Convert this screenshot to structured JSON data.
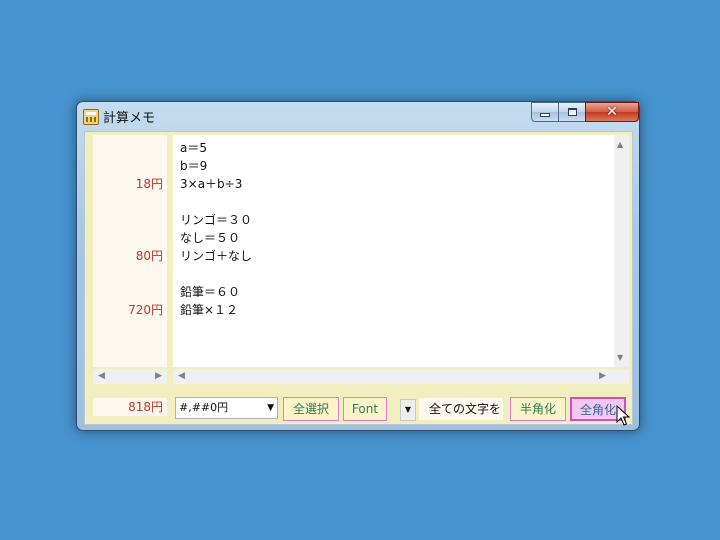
{
  "window": {
    "title": "計算メモ"
  },
  "results": {
    "rows": [
      {
        "line": 3,
        "value": "18円"
      },
      {
        "line": 7,
        "value": "80円"
      },
      {
        "line": 10,
        "value": "720円"
      }
    ],
    "total": "818円"
  },
  "editor": {
    "lines": [
      "a＝5",
      "b＝9",
      "3×a＋b÷3",
      "",
      "リンゴ＝３０",
      "なし＝５０",
      "リンゴ＋なし",
      "",
      "鉛筆＝６０",
      "鉛筆×１２"
    ]
  },
  "toolbar": {
    "format_value": "#,##0円",
    "select_all_label": "全選択",
    "font_label": "Font",
    "target_value": "全ての文字を",
    "halfwidth_label": "半角化",
    "fullwidth_label": "全角化"
  },
  "colors": {
    "desktop": "#4793cf",
    "result_text": "#c0392b",
    "button_text": "#2e7d4f",
    "button_border": "#e080d0"
  },
  "icons": {
    "app": "calculator-icon",
    "cursor": "mouse-pointer-icon"
  }
}
